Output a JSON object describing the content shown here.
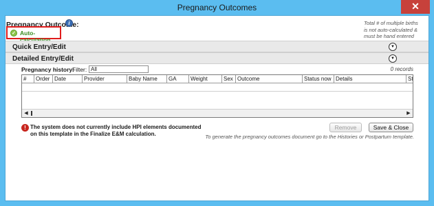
{
  "window": {
    "title": "Pregnancy Outcomes",
    "close_glyph": "✕"
  },
  "header": {
    "label": "Pregnancy Outcome:",
    "info_glyph": "i",
    "note": "Total # of multiple births is not auto-calculated & must be hand entered below"
  },
  "autocalc": {
    "label": "Auto-calculation",
    "icon": "check-circle-icon",
    "highlight_color": "#e01c1c"
  },
  "sections": {
    "quick": {
      "label": "Quick Entry/Edit",
      "toggle_icon": "chevron-down-circle-icon"
    },
    "detailed": {
      "label": "Detailed Entry/Edit",
      "toggle_icon": "chevron-down-circle-icon"
    }
  },
  "history": {
    "label": "Pregnancy history:",
    "filter_label": "Filter:",
    "filter_value": "All",
    "records": "0 records"
  },
  "grid": {
    "columns": [
      "#",
      "Order",
      "Date",
      "Provider",
      "Baby Name",
      "GA",
      "Weight",
      "Sex",
      "Outcome",
      "Status now",
      "Details",
      "St"
    ],
    "rows": []
  },
  "warning": {
    "icon": "exclamation-circle-icon",
    "text": "The system does not currently include HPI elements documented on this template in the Finalize E&M calculation."
  },
  "buttons": {
    "remove": "Remove",
    "save_close": "Save & Close"
  },
  "footer_note": "To generate the pregnancy outcomes document go to the Histories or Postpartum template.",
  "colors": {
    "titlebar": "#5bbdf0",
    "close": "#c7413b",
    "autocalc_text": "#3a8c1f",
    "warning": "#c8261f"
  }
}
